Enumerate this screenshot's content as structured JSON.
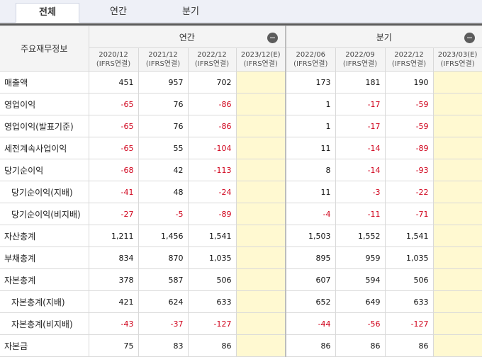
{
  "tabs": [
    {
      "label": "전체",
      "active": true
    },
    {
      "label": "연간",
      "active": false
    },
    {
      "label": "분기",
      "active": false
    }
  ],
  "table": {
    "corner_label": "주요재무정보",
    "groups": {
      "annual": "연간",
      "quarterly": "분기"
    },
    "periods": [
      {
        "date": "2020/12",
        "basis": "(IFRS연결)"
      },
      {
        "date": "2021/12",
        "basis": "(IFRS연결)"
      },
      {
        "date": "2022/12",
        "basis": "(IFRS연결)"
      },
      {
        "date": "2023/12(E)",
        "basis": "(IFRS연결)"
      },
      {
        "date": "2022/06",
        "basis": "(IFRS연결)"
      },
      {
        "date": "2022/09",
        "basis": "(IFRS연결)"
      },
      {
        "date": "2022/12",
        "basis": "(IFRS연결)"
      },
      {
        "date": "2023/03(E)",
        "basis": "(IFRS연결)"
      }
    ],
    "rows": [
      {
        "label": "매출액",
        "indent": false,
        "values": [
          "451",
          "957",
          "702",
          "",
          "173",
          "181",
          "190",
          ""
        ]
      },
      {
        "label": "영업이익",
        "indent": false,
        "values": [
          "-65",
          "76",
          "-86",
          "",
          "1",
          "-17",
          "-59",
          ""
        ]
      },
      {
        "label": "영업이익(발표기준)",
        "indent": false,
        "values": [
          "-65",
          "76",
          "-86",
          "",
          "1",
          "-17",
          "-59",
          ""
        ]
      },
      {
        "label": "세전계속사업이익",
        "indent": false,
        "values": [
          "-65",
          "55",
          "-104",
          "",
          "11",
          "-14",
          "-89",
          ""
        ]
      },
      {
        "label": "당기순이익",
        "indent": false,
        "values": [
          "-68",
          "42",
          "-113",
          "",
          "8",
          "-14",
          "-93",
          ""
        ]
      },
      {
        "label": "당기순이익(지배)",
        "indent": true,
        "values": [
          "-41",
          "48",
          "-24",
          "",
          "11",
          "-3",
          "-22",
          ""
        ]
      },
      {
        "label": "당기순이익(비지배)",
        "indent": true,
        "values": [
          "-27",
          "-5",
          "-89",
          "",
          "-4",
          "-11",
          "-71",
          ""
        ]
      },
      {
        "label": "자산총계",
        "indent": false,
        "values": [
          "1,211",
          "1,456",
          "1,541",
          "",
          "1,503",
          "1,552",
          "1,541",
          ""
        ]
      },
      {
        "label": "부채총계",
        "indent": false,
        "values": [
          "834",
          "870",
          "1,035",
          "",
          "895",
          "959",
          "1,035",
          ""
        ]
      },
      {
        "label": "자본총계",
        "indent": false,
        "values": [
          "378",
          "587",
          "506",
          "",
          "607",
          "594",
          "506",
          ""
        ]
      },
      {
        "label": "자본총계(지배)",
        "indent": true,
        "values": [
          "421",
          "624",
          "633",
          "",
          "652",
          "649",
          "633",
          ""
        ]
      },
      {
        "label": "자본총계(비지배)",
        "indent": true,
        "values": [
          "-43",
          "-37",
          "-127",
          "",
          "-44",
          "-56",
          "-127",
          ""
        ]
      },
      {
        "label": "자본금",
        "indent": false,
        "values": [
          "75",
          "83",
          "86",
          "",
          "86",
          "86",
          "86",
          ""
        ]
      }
    ]
  },
  "colors": {
    "negative": "#d0021b",
    "estimate_bg": "#fff9d1",
    "header_bg": "#f4f4f4"
  }
}
